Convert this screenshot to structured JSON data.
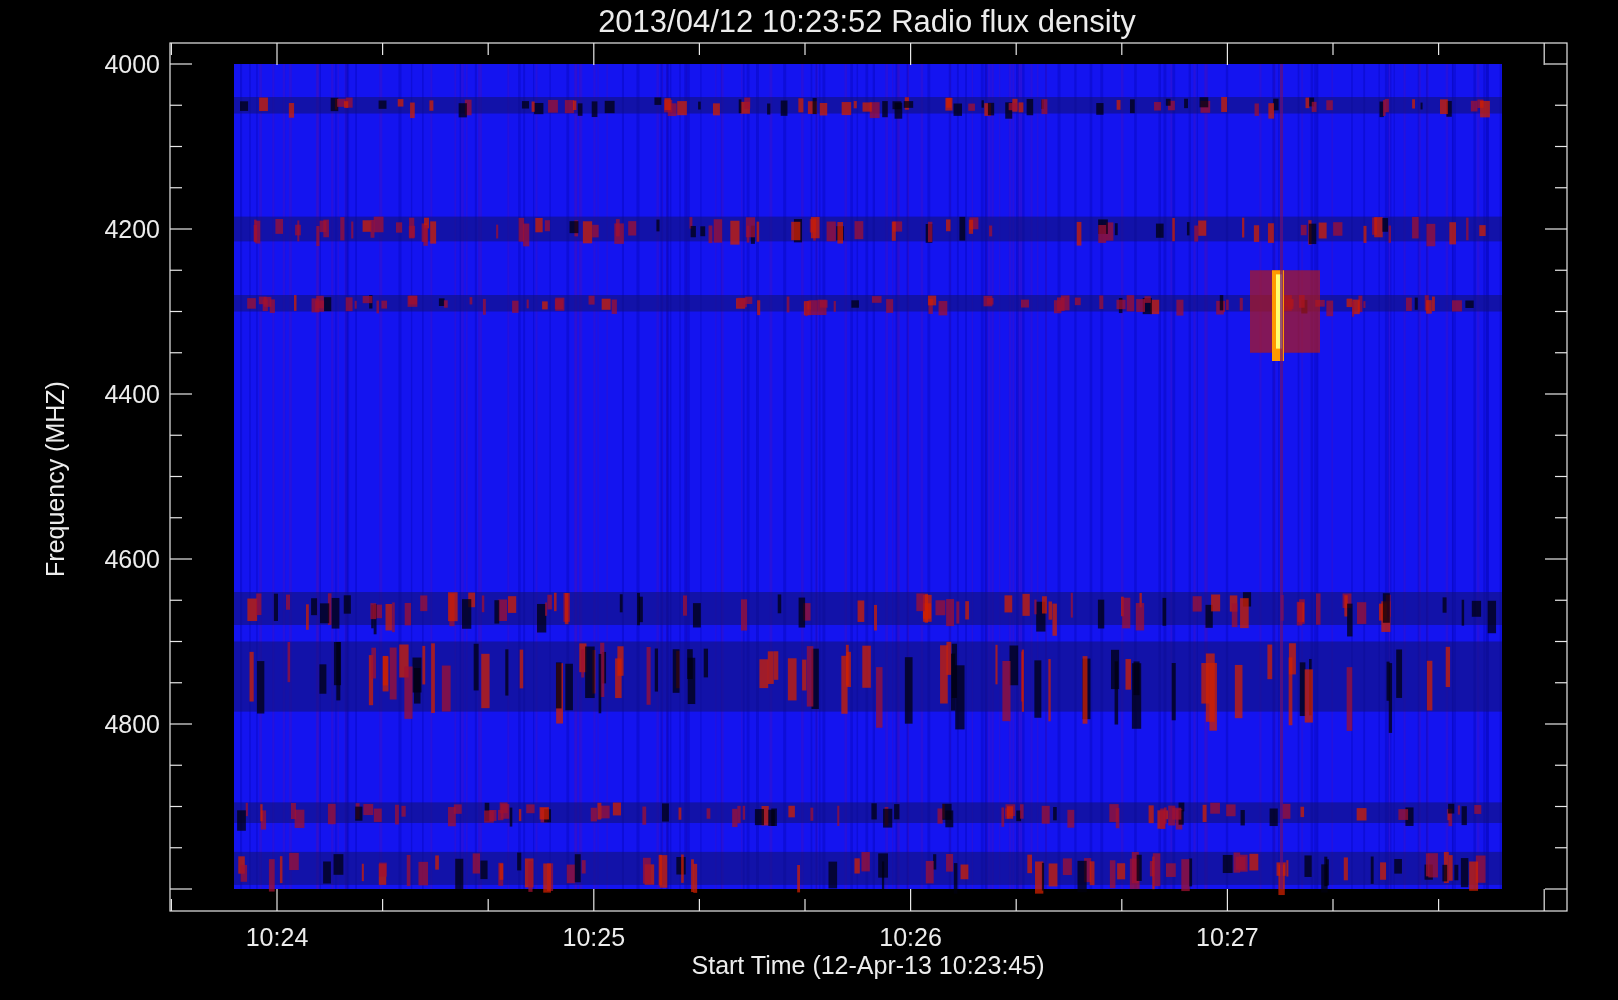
{
  "title": "2013/04/12 10:23:52 Radio flux density",
  "y_axis": {
    "label": "Frequency (MHZ)",
    "ticks": [
      "4000",
      "4200",
      "4400",
      "4600",
      "4800"
    ]
  },
  "x_axis": {
    "label": "Start Time (12-Apr-13 10:23:45)",
    "ticks": [
      "10:24",
      "10:25",
      "10:26",
      "10:27"
    ]
  }
}
